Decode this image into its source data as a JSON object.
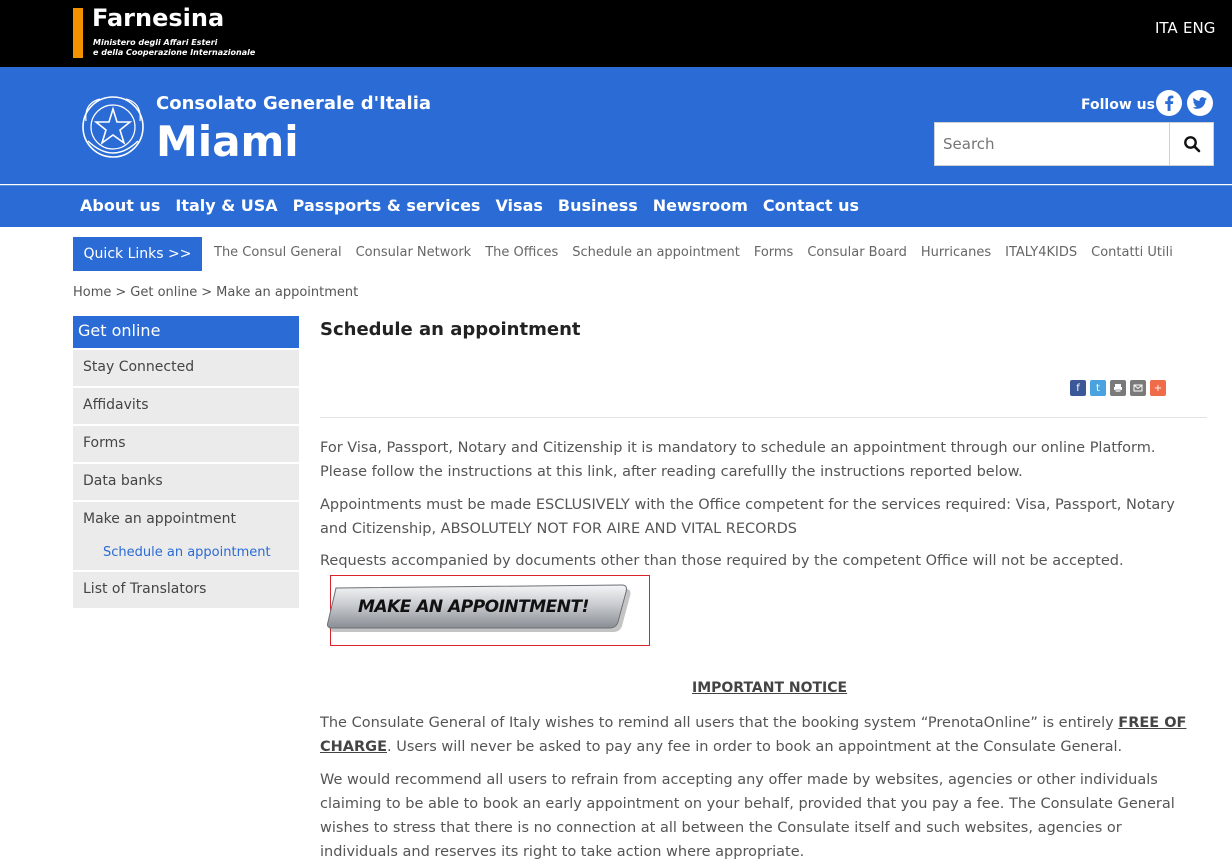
{
  "topbar": {
    "brand": "Farnesina",
    "subtitle_line1": "Ministero degli Affari Esteri",
    "subtitle_line2": "e della Cooperazione Internazionale",
    "lang_ita": "ITA",
    "lang_eng": "ENG"
  },
  "header": {
    "consolato": "Consolato Generale d'Italia",
    "city": "Miami",
    "follow": "Follow us",
    "search_placeholder": "Search"
  },
  "nav": {
    "items": [
      "About us",
      "Italy & USA",
      "Passports & services",
      "Visas",
      "Business",
      "Newsroom",
      "Contact us"
    ]
  },
  "quicklinks": {
    "button": "Quick Links >>",
    "items": [
      "The Consul General",
      "Consular Network",
      "The Offices",
      "Schedule an appointment",
      "Forms",
      "Consular Board",
      "Hurricanes",
      "ITALY4KIDS",
      "Contatti Utili"
    ]
  },
  "breadcrumb": {
    "items": [
      "Home",
      "Get online",
      "Make an appointment"
    ],
    "separator": ">"
  },
  "sidebar": {
    "title": "Get online",
    "items": [
      "Stay Connected",
      "Affidavits",
      "Forms",
      "Data banks",
      "Make an appointment"
    ],
    "subitem": "Schedule an appointment",
    "last_item": "List of Translators"
  },
  "content": {
    "title": "Schedule an appointment",
    "p1": "For Visa, Passport, Notary and Citizenship it is mandatory to schedule an appointment through our online Platform. Please follow the instructions at this link, after reading carefullly the instructions reported below.",
    "p2": "Appointments must be made ESCLUSIVELY with the Office competent for the services required: Visa, Passport, Notary and Citizenship, ABSOLUTELY NOT FOR AIRE AND VITAL RECORDS",
    "p3": "Requests accompanied by documents other than those required by the competent Office will not be accepted.",
    "button": "MAKE AN APPOINTMENT!",
    "notice": "IMPORTANT NOTICE",
    "p5_a": "The Consulate General of Italy wishes to remind all users that the booking system “PrenotaOnline” is entirely ",
    "p5_b": "FREE OF CHARGE",
    "p5_c": ". Users will never be asked to pay any fee in order to book an appointment at the Consulate General.",
    "p6": "We would recommend all users to refrain from accepting any offer made by websites, agencies or other individuals claiming to be able to book an early appointment on your behalf, provided that you pay a fee. The Consulate General wishes to stress that there is no connection at all between the Consulate itself and such websites, agencies or individuals and reserves its right to take action where appropriate."
  },
  "colors": {
    "brand_blue": "#2a6bd5",
    "accent_orange": "#f39200",
    "highlight_red": "#d9232d"
  }
}
